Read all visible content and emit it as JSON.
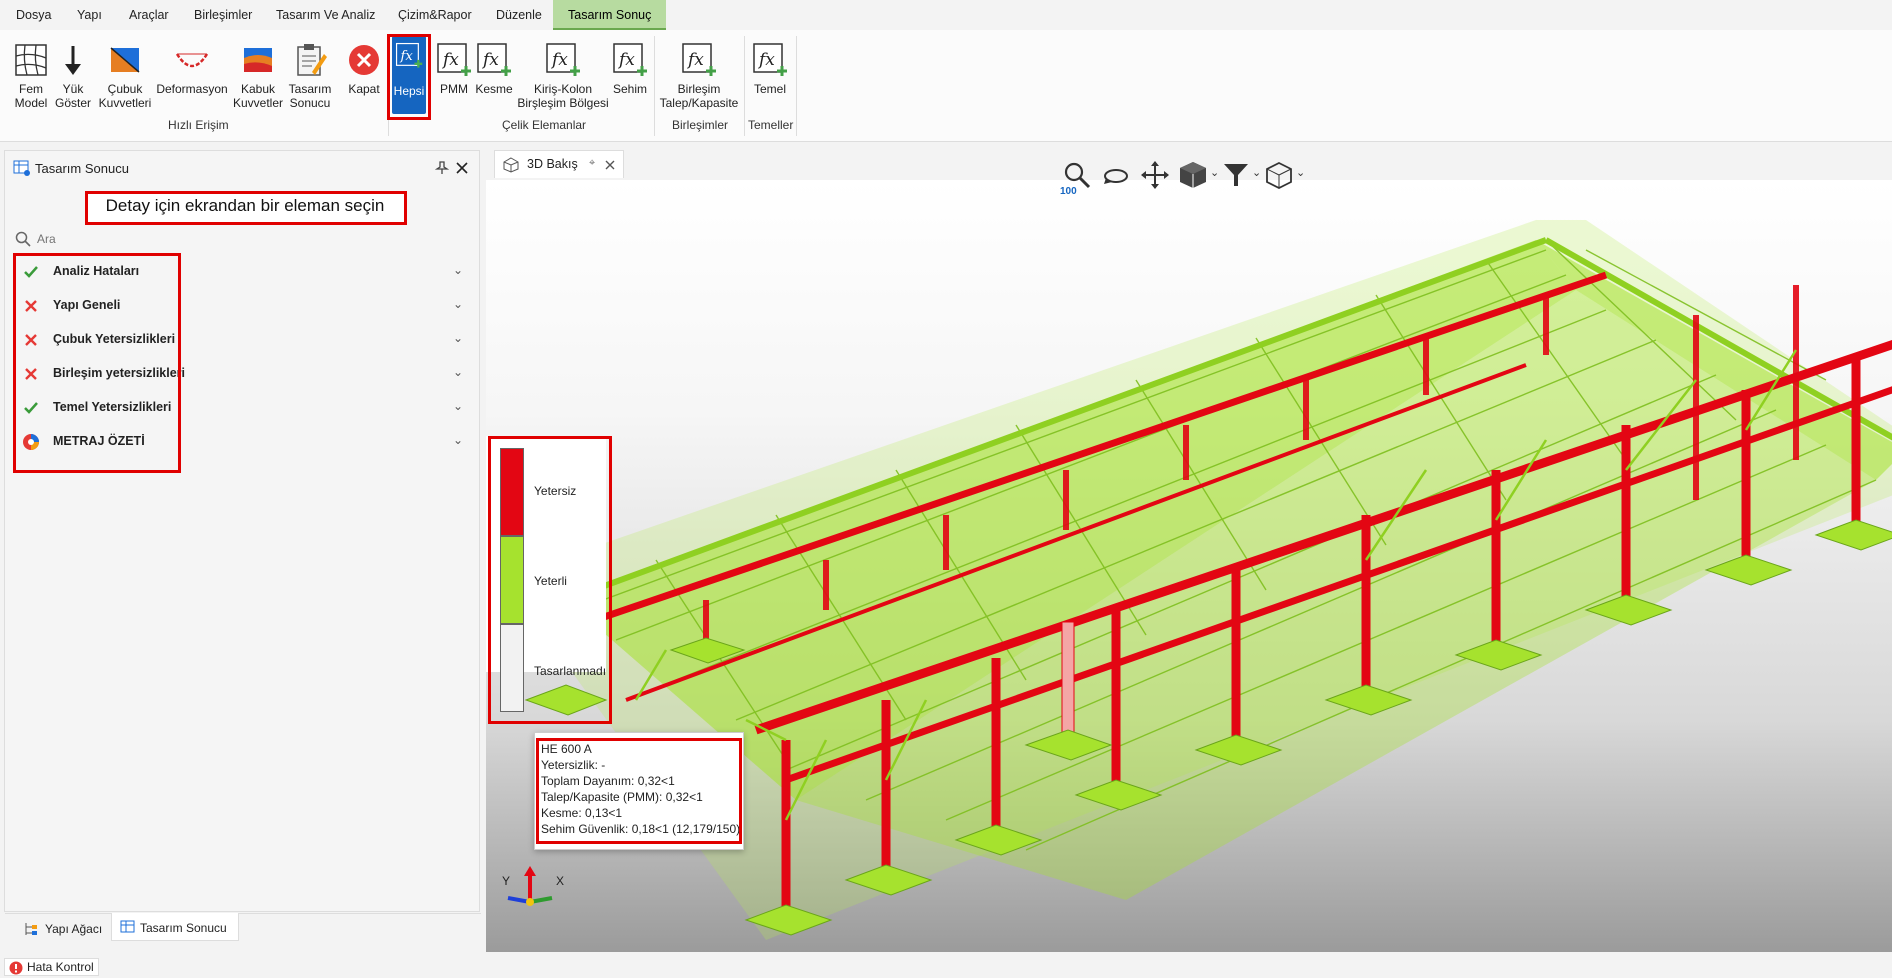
{
  "menu": [
    "Dosya",
    "Yapı",
    "Araçlar",
    "Birleşimler",
    "Tasarım Ve Analiz",
    "Çizim&Rapor",
    "Düzenle",
    "Tasarım Sonuç"
  ],
  "ribbon": {
    "buttons": {
      "fem": "Fem\nModel",
      "yuk": "Yük\nGöster",
      "cubuk": "Çubuk\nKuvvetleri",
      "deformasyon": "Deformasyon",
      "kabuk": "Kabuk\nKuvvetler",
      "tasarim": "Tasarım\nSonucu",
      "kapat": "Kapat",
      "hepsi": "Hepsi",
      "pmm": "PMM",
      "kesme": "Kesme",
      "kiris": "Kiriş-Kolon\nBirşleşim Bölgesi",
      "sehim": "Sehim",
      "birlesim": "Birleşim\nTalep/Kapasite",
      "temel": "Temel"
    },
    "groups": {
      "hizli": "Hızlı Erişim",
      "celik": "Çelik Elemanlar",
      "birlesimler": "Birleşimler",
      "temeller": "Temeller"
    }
  },
  "panel": {
    "title": "Tasarım Sonucu",
    "instruction": "Detay için ekrandan bir eleman seçin",
    "search_placeholder": "Ara",
    "items": [
      {
        "label": "Analiz Hataları",
        "status": "ok"
      },
      {
        "label": "Yapı Geneli",
        "status": "error"
      },
      {
        "label": "Çubuk Yetersizlikleri",
        "status": "error"
      },
      {
        "label": "Birleşim yetersizlikleri",
        "status": "error"
      },
      {
        "label": "Temel Yetersizlikleri",
        "status": "ok"
      },
      {
        "label": "METRAJ ÖZETİ",
        "status": "metraj"
      }
    ],
    "bottom_tabs": [
      "Yapı Ağacı",
      "Tasarım Sonucu"
    ]
  },
  "view": {
    "tab_label": "3D Bakış",
    "zoom_level": "100",
    "legend": [
      "Yetersiz",
      "Yeterli",
      "Tasarlanmadı"
    ],
    "tooltip": [
      "HE 600 A",
      "Yetersizlik: -",
      "Toplam Dayanım: 0,32<1",
      "Talep/Kapasite (PMM): 0,32<1",
      "Kesme: 0,13<1",
      "Sehim Güvenlik: 0,18<1 (12,179/150)"
    ],
    "axis_labels": {
      "x": "X",
      "y": "Y"
    }
  },
  "statusbar": {
    "hata": "Hata Kontrol"
  },
  "colors": {
    "insufficient": "#e30613",
    "sufficient": "#a6e22e",
    "undesigned": "#f2f2f2",
    "accent": "#1565c0"
  }
}
